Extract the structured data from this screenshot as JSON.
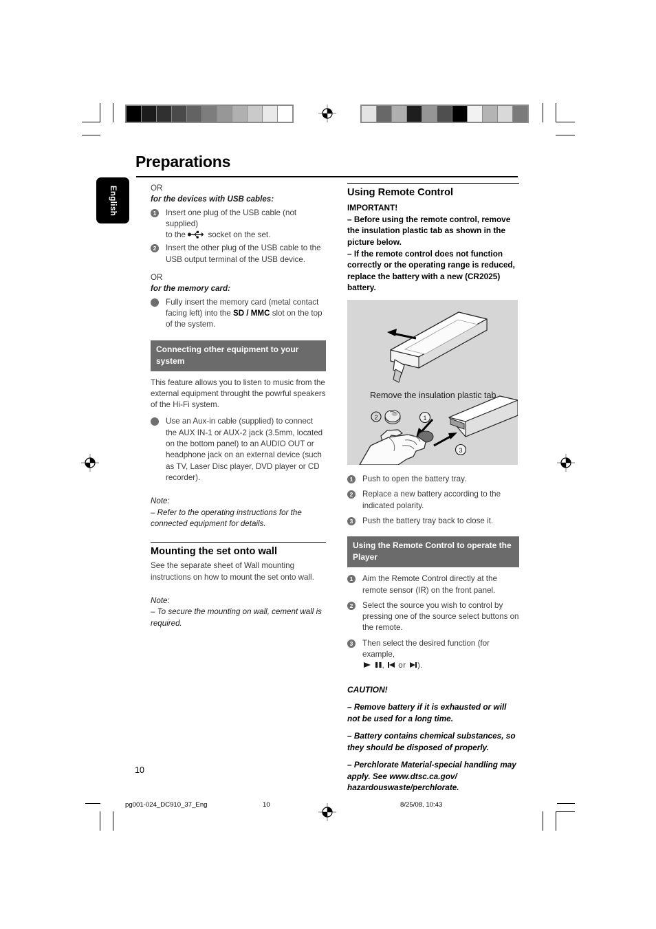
{
  "page": {
    "title": "Preparations",
    "language_tab": "English",
    "folio": "10"
  },
  "left_column": {
    "or_1": "OR",
    "usb_heading": "for the devices with USB cables:",
    "usb_step1_a": "Insert one plug of the USB cable (not supplied)",
    "usb_step1_b_pre": "to the",
    "usb_step1_b_post": "socket on the set.",
    "usb_step1_icon": "usb-icon",
    "usb_step2": "Insert the other plug of the USB cable to the USB output terminal of the USB device.",
    "or_2": "OR",
    "card_heading": "for the memory card:",
    "card_bullet_pre": "Fully insert the memory card (metal contact facing left) into the",
    "card_bullet_bold": "SD / MMC",
    "card_bullet_post": "slot on the top of the system.",
    "connect_band": "Connecting other equipment to your system",
    "connect_intro": "This feature allows you to listen to music from the external equipment throught the powrful speakers of the Hi-Fi system.",
    "connect_bullet": "Use an Aux-in cable (supplied) to connect the AUX IN-1 or AUX-2  jack (3.5mm, located on the bottom panel) to an AUDIO OUT or headphone jack on an external device (such as TV, Laser Disc player, DVD player or CD recorder).",
    "note_label_1": "Note:",
    "note_text_1": "–  Refer to the operating instructions for the connected equipment for details.",
    "mounting_heading": "Mounting the set onto wall",
    "mounting_text": "See the separate sheet of Wall mounting instructions on how to mount the set onto wall.",
    "note_label_2": "Note:",
    "note_text_2": "–  To secure the mounting on wall, cement wall is required."
  },
  "right_column": {
    "heading": "Using Remote Control",
    "important_label": "IMPORTANT!",
    "important_line_1": "–  Before using the remote control, remove the insulation plastic tab as shown in the picture below.",
    "important_line_2": "–  If the remote control does not function correctly or the operating range is reduced, replace the battery with a new (CR2025) battery.",
    "figure": {
      "name": "remote-battery-illustration",
      "caption": "Remove the insulation plastic tab",
      "callouts": [
        "1",
        "2",
        "3"
      ],
      "background_color": "#d6d6d6"
    },
    "battery_steps": [
      "Push to open the battery tray.",
      "Replace a new battery according to the indicated polarity.",
      "Push the battery tray back to close it."
    ],
    "operate_band": "Using the Remote Control to operate the Player",
    "operate_steps": [
      "Aim the Remote Control directly at the remote sensor (IR) on the front panel.",
      "Select the source you wish to control by pressing one of the source select buttons on the remote."
    ],
    "operate_step3_pre": "Then select the desired function (for example,",
    "operate_step3_symbols": "▶ ▐▐, ◀▐ or ▐▶",
    "operate_step3_post": ").",
    "caution_label": "CAUTION!",
    "caution_1": "–  Remove battery if it is exhausted or will not be used for a long time.",
    "caution_2": "–  Battery contains chemical substances, so they should be disposed of properly.",
    "caution_3": "–   Perchlorate Material-special handling may apply. See www.dtsc.ca.gov/ hazardouswaste/perchlorate."
  },
  "footer": {
    "file": "pg001-024_DC910_37_Eng",
    "page": "10",
    "date": "8/25/08, 10:43"
  },
  "printer_marks": {
    "left_wedge": [
      "#000000",
      "#1c1c1c",
      "#303030",
      "#4a4a4a",
      "#636363",
      "#7d7d7d",
      "#979797",
      "#b0b0b0",
      "#cacaca",
      "#e9e9e9",
      "#ffffff"
    ],
    "right_wedge": [
      "#e4e4e4",
      "#686868",
      "#afafaf",
      "#1e1e1e",
      "#969696",
      "#4f4f4f",
      "#000000",
      "#f2f2f2",
      "#b4b4b4",
      "#d9d9d9",
      "#7a7a7a"
    ]
  }
}
